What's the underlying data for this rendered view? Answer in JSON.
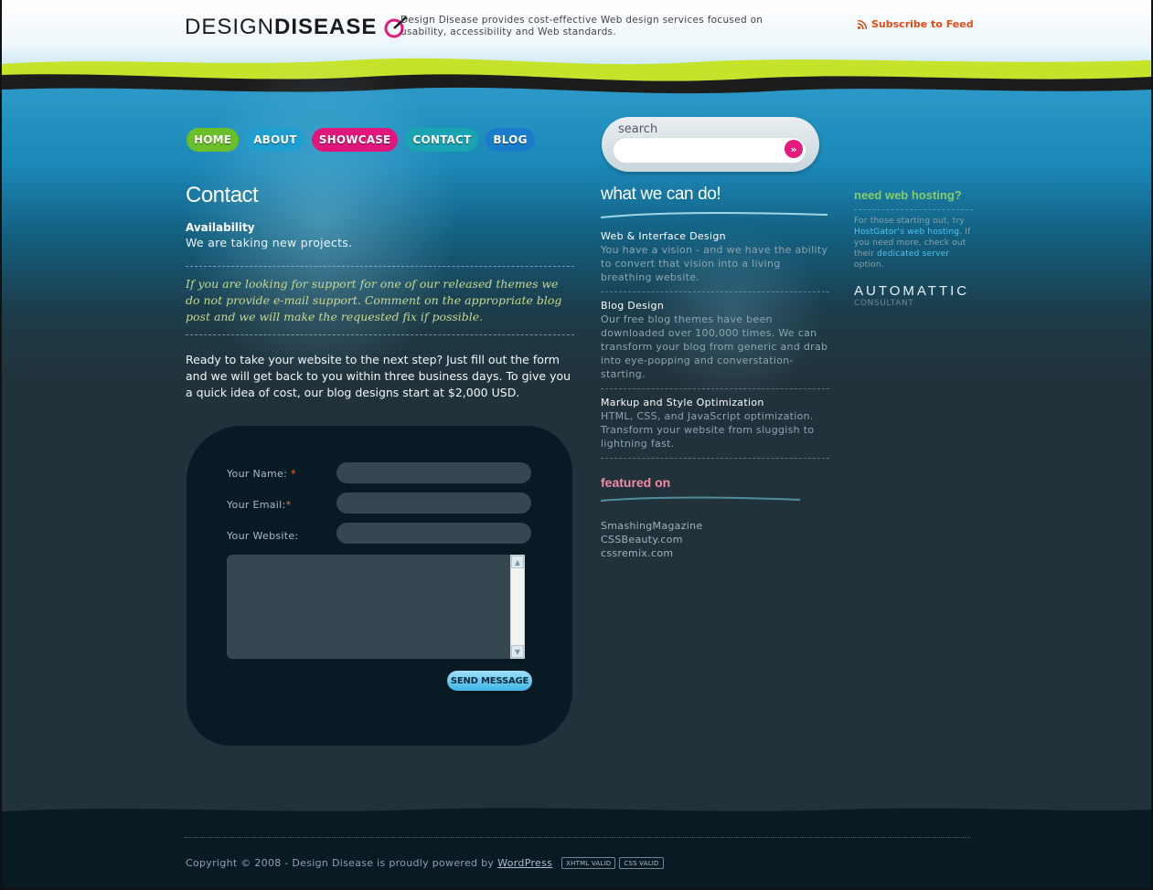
{
  "header": {
    "logo_light": "DESIGN",
    "logo_bold": "DISEASE",
    "tagline": "Design Disease provides cost-effective Web design services focused on usability, accessibility and Web standards.",
    "subscribe": "Subscribe to Feed"
  },
  "nav": {
    "items": [
      "HOME",
      "ABOUT",
      "SHOWCASE",
      "CONTACT",
      "BLOG"
    ]
  },
  "search": {
    "label": "search",
    "button_glyph": "»"
  },
  "main": {
    "title": "Contact",
    "availability_heading": "Availability",
    "availability_text": "We are taking new projects.",
    "support_note": "If you are looking for support for one of our released themes we do not provide e-mail support. Comment on the appropriate blog post and we will make the requested fix if possible.",
    "intro": "Ready to take your website to the next step? Just fill out the form and we will get back to you within three business days. To give you a quick idea of cost, our blog designs start at $2,000 USD."
  },
  "form": {
    "name_label": "Your Name:",
    "email_label": "Your Email:",
    "website_label": "Your Website:",
    "required_mark": "*",
    "send_label": "SEND MESSAGE"
  },
  "services": {
    "heading": "what we can do!",
    "items": [
      {
        "title": "Web & Interface Design",
        "desc": "You have a vision - and we have the ability to convert that vision into a living breathing website."
      },
      {
        "title": "Blog Design",
        "desc": "Our free blog themes have been downloaded over 100,000 times. We can transform your blog from generic and drab into eye-popping and converstation-starting."
      },
      {
        "title": "Markup and Style Optimization",
        "desc": "HTML, CSS, and JavaScript optimization. Transform your website from sluggish to lightning fast."
      }
    ]
  },
  "featured": {
    "heading": "featured on",
    "items": [
      "SmashingMagazine",
      "CSSBeauty.com",
      "cssremix.com"
    ]
  },
  "hosting": {
    "heading": "need web hosting?",
    "text_1": "For those starting out, try ",
    "link_1": "HostGator's web hosting",
    "text_2": ". If you need more, check out their ",
    "link_2": "dedicated server",
    "text_3": " option.",
    "automattic": "AUTOMATTIC",
    "automattic_sub": "CONSULTANT"
  },
  "footer": {
    "copyright": "Copyright © 2008 - Design Disease is proudly powered by",
    "powered_link": "WordPress",
    "badge_xhtml": "XHTML VALID",
    "badge_css": "CSS VALID"
  },
  "colors": {
    "accent_green": "#86cc6a",
    "accent_pink": "#e51a7c",
    "water": "#1b88b8",
    "dark": "#22323a"
  }
}
